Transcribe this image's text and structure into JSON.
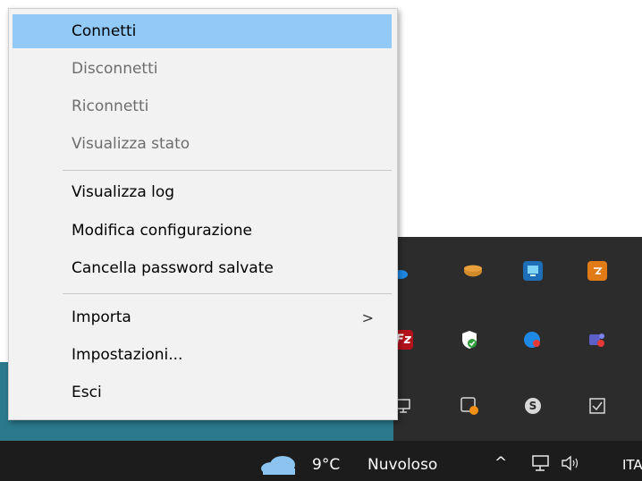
{
  "menu": {
    "items": [
      {
        "label": "Connetti",
        "enabled": true,
        "highlighted": true
      },
      {
        "label": "Disconnetti",
        "enabled": false
      },
      {
        "label": "Riconnetti",
        "enabled": false
      },
      {
        "label": "Visualizza stato",
        "enabled": false
      },
      {
        "label": "Visualizza log",
        "enabled": true
      },
      {
        "label": "Modifica configurazione",
        "enabled": true
      },
      {
        "label": "Cancella password salvate",
        "enabled": true
      },
      {
        "label": "Importa",
        "enabled": true,
        "has_submenu": true
      },
      {
        "label": "Impostazioni...",
        "enabled": true
      },
      {
        "label": "Esci",
        "enabled": true
      }
    ],
    "submenu_glyph": ">"
  },
  "tray_icons": [
    {
      "name": "onedrive-icon",
      "color": "#1e88e5"
    },
    {
      "name": "db-icon",
      "color": "#d08a2a"
    },
    {
      "name": "network-app-icon",
      "color": "#1e6fb8"
    },
    {
      "name": "amazon-app-icon",
      "color": "#e07b16"
    },
    {
      "name": "filezilla-icon",
      "color": "#b3121b"
    },
    {
      "name": "security-shield-icon",
      "color": "#ffffff"
    },
    {
      "name": "chat-app-icon",
      "color": "#1e88e5"
    },
    {
      "name": "teams-icon",
      "color": "#5b5fc7"
    },
    {
      "name": "network-computer-icon",
      "color": "#d8d8d8"
    },
    {
      "name": "sync-app-icon",
      "color": "#d8d8d8"
    },
    {
      "name": "skype-icon",
      "color": "#d8d8d8"
    },
    {
      "name": "task-check-icon",
      "color": "#d8d8d8"
    }
  ],
  "taskbar": {
    "temperature": "9°C",
    "weather": "Nuvoloso",
    "chevron": "^",
    "language": "ITA"
  }
}
